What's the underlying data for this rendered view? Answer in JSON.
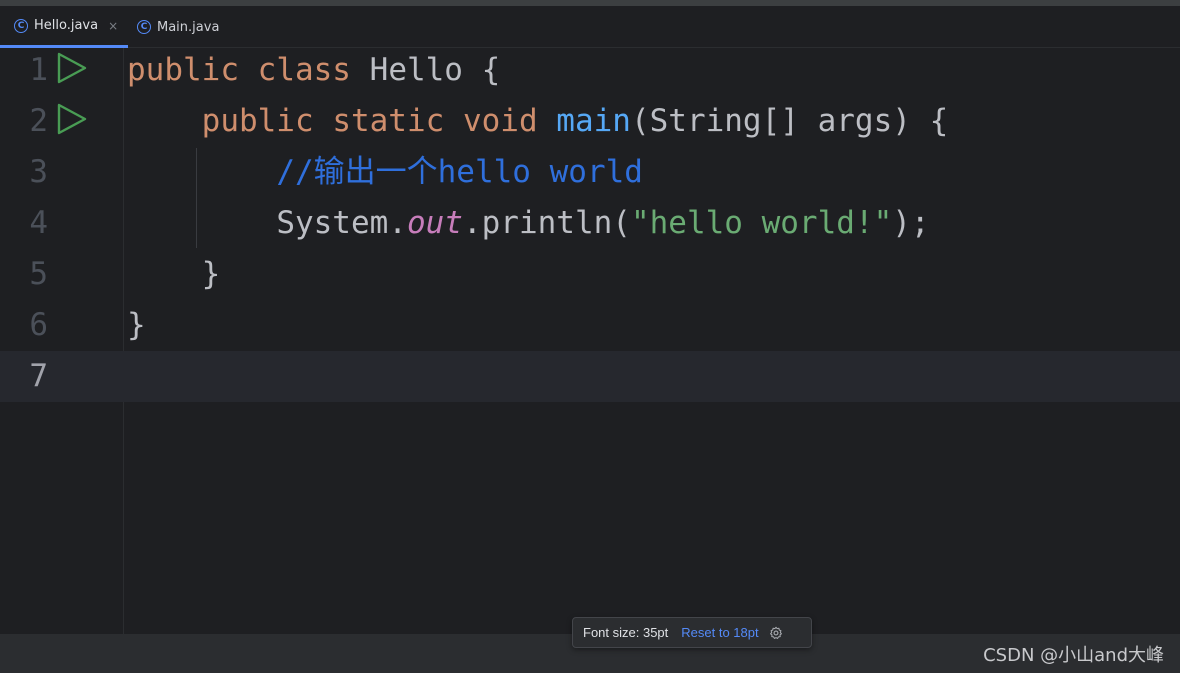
{
  "tabs": [
    {
      "label": "Hello.java",
      "icon": "class-icon",
      "active": true
    },
    {
      "label": "Main.java",
      "icon": "class-icon",
      "active": false
    }
  ],
  "close_glyph": "×",
  "class_glyph": "C",
  "line_numbers": [
    "1",
    "2",
    "3",
    "4",
    "5",
    "6",
    "7"
  ],
  "code": {
    "line1": {
      "kw1": "public",
      "kw2": "class",
      "rest": "Hello {"
    },
    "line2": {
      "kw1": "public",
      "kw2": "static",
      "kw3": "void",
      "fn": "main",
      "rest": "(String[] args) {"
    },
    "line3": {
      "comment": "//输出一个hello world"
    },
    "line4": {
      "pre": "System.",
      "field": "out",
      "mid": ".println(",
      "str": "\"hello world!\"",
      "post": ");"
    },
    "line5": {
      "text": "}"
    },
    "line6": {
      "text": "}"
    }
  },
  "current_line": "7",
  "font_popup": {
    "label": "Font size: 35pt",
    "reset_label": "Reset to 18pt",
    "icon": "gear-icon"
  },
  "watermark": "CSDN @小山and大峰",
  "colors": {
    "keyword": "#cf8e6d",
    "function": "#56a8f5",
    "string": "#6aab73",
    "comment": "#2f6fdc",
    "field": "#c77dbb",
    "run": "#499c54",
    "accent": "#548af7"
  }
}
